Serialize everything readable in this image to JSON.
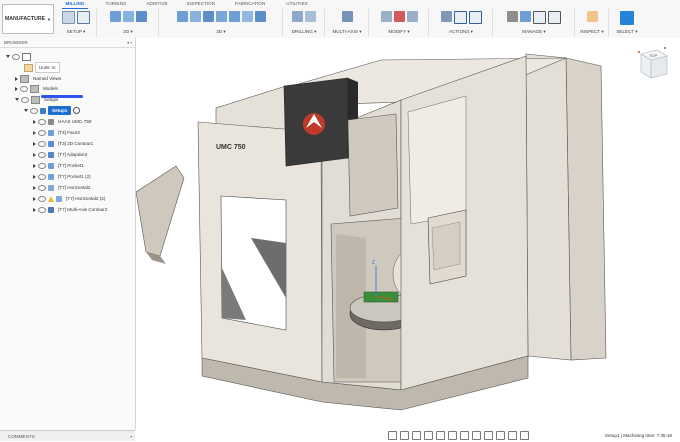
{
  "workspace": {
    "label": "MANUFACTURE"
  },
  "tabs": [
    {
      "label": "MILLING",
      "active": true
    },
    {
      "label": "TURNING"
    },
    {
      "label": "ADDITIVE"
    },
    {
      "label": "INSPECTION"
    },
    {
      "label": "FABRICATION"
    },
    {
      "label": "UTILITIES"
    }
  ],
  "groups": [
    {
      "label": "SETUP ▾"
    },
    {
      "label": "2D ▾"
    },
    {
      "label": "3D ▾"
    },
    {
      "label": "DRILLING ▾"
    },
    {
      "label": "MULTI-AXIS ▾"
    },
    {
      "label": "MODIFY ▾"
    },
    {
      "label": "ACTIONS ▾"
    },
    {
      "label": "MANAGE ▾"
    },
    {
      "label": "INSPECT ▾"
    },
    {
      "label": "SELECT ▾"
    }
  ],
  "browser": {
    "title": "BROWSER",
    "units": "Units: in",
    "named_views": "Named Views",
    "models": "Models",
    "setups": "Setups",
    "setup1": "Setup1",
    "machine": "HAAS UMC-750",
    "operations": [
      "[T4] Face2",
      "[T3] 2D Contour1",
      "[T7] Adaptive2",
      "[T7] Pocket1",
      "[T7] Pocket1 (2)",
      "[T7] Horizontal2",
      "[T7] Horizontal2 (2)",
      "[T7] Multi-Axis Contour2"
    ]
  },
  "comments": {
    "label": "COMMENTS"
  },
  "machine_brand": "UMC 750",
  "viewcube": {
    "label": "TOP"
  },
  "status": {
    "text": "Setup1 | Machining time: 7:35:19"
  },
  "colors": {
    "accent": "#1c6fd1",
    "machine_body": "#e9e4dc",
    "machine_dark": "#3a3a3a",
    "haas_red": "#c0392b"
  }
}
